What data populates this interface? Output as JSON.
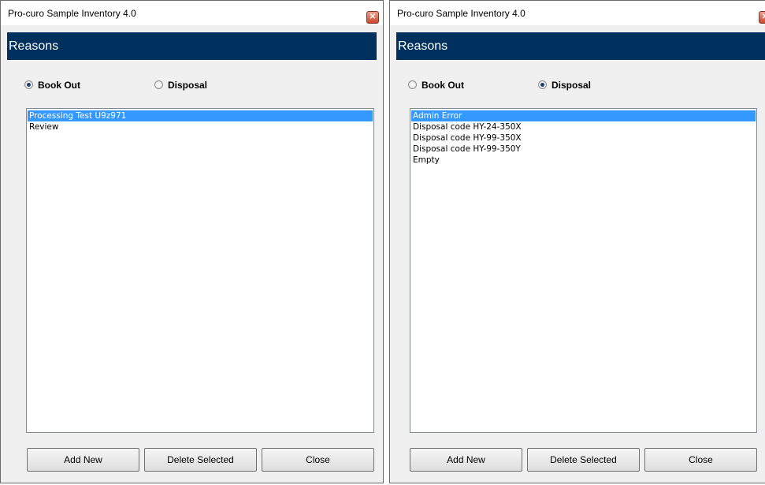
{
  "windows": [
    {
      "title": "Pro-curo Sample Inventory 4.0",
      "close_glyph": "✕",
      "header": "Reasons",
      "radios": {
        "book_out": "Book Out",
        "disposal": "Disposal",
        "selected": "book_out"
      },
      "list_items": [
        {
          "label": "Processing Test U9z971",
          "selected": true
        },
        {
          "label": "Review",
          "selected": false
        }
      ],
      "buttons": {
        "add_new": "Add New",
        "delete_selected": "Delete Selected",
        "close": "Close"
      }
    },
    {
      "title": "Pro-curo Sample Inventory 4.0",
      "close_glyph": "✕",
      "header": "Reasons",
      "radios": {
        "book_out": "Book Out",
        "disposal": "Disposal",
        "selected": "disposal"
      },
      "list_items": [
        {
          "label": "Admin Error",
          "selected": true
        },
        {
          "label": "Disposal code HY-24-350X",
          "selected": false
        },
        {
          "label": "Disposal code HY-99-350X",
          "selected": false
        },
        {
          "label": "Disposal code HY-99-350Y",
          "selected": false
        },
        {
          "label": "Empty",
          "selected": false
        }
      ],
      "buttons": {
        "add_new": "Add New",
        "delete_selected": "Delete Selected",
        "close": "Close"
      }
    }
  ],
  "colors": {
    "header_band": "#00305e",
    "selection": "#3399ff",
    "close_button": "#c8492e"
  },
  "icons": {
    "close": "close-icon",
    "radio": "radio-button"
  }
}
